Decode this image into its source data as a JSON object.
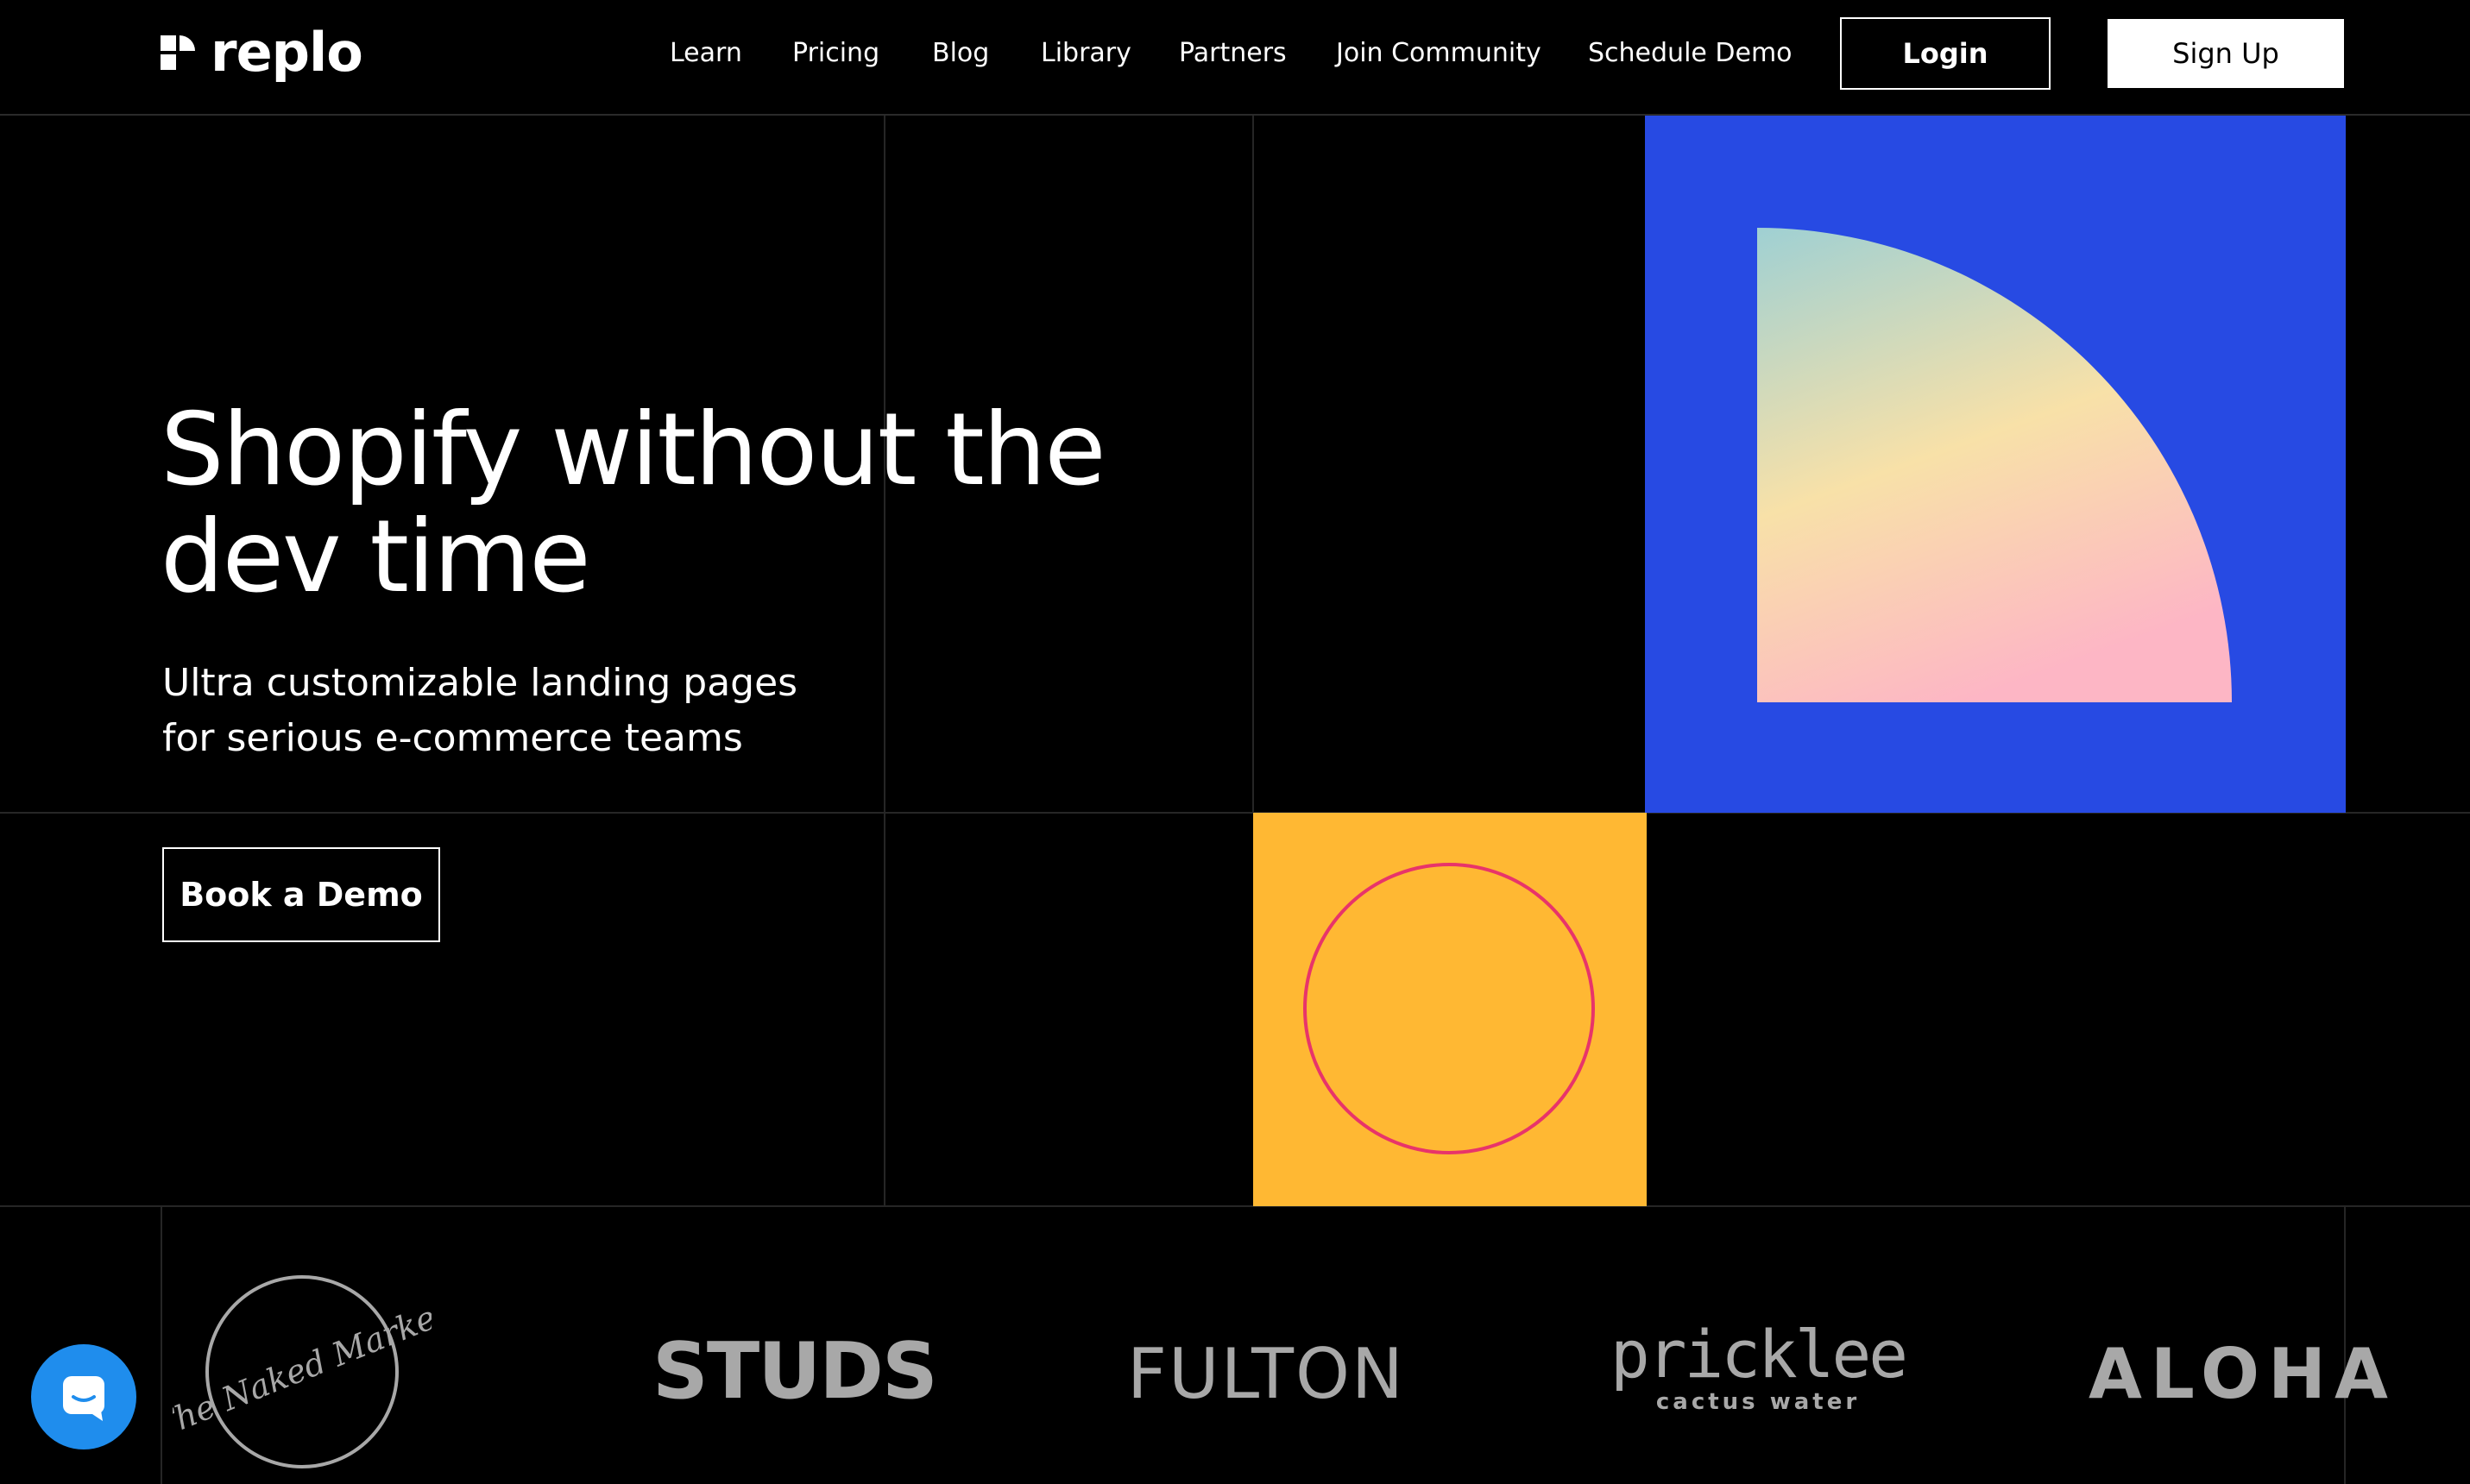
{
  "brand": {
    "name": "replo"
  },
  "nav": {
    "links": [
      "Learn",
      "Pricing",
      "Blog",
      "Library",
      "Partners",
      "Join Community",
      "Schedule Demo"
    ],
    "login_label": "Login",
    "signup_label": "Sign Up"
  },
  "hero": {
    "title_line1": "Shopify without the",
    "title_line2": "dev time",
    "subtitle_line1": "Ultra customizable landing pages",
    "subtitle_line2": "for serious e-commerce teams",
    "cta_label": "Book a Demo"
  },
  "colors": {
    "background": "#000000",
    "blue_block": "#274ae3",
    "yellow_block": "#ffb833",
    "ring": "#e8346a",
    "chat": "#1f8ded"
  },
  "customer_logos": {
    "naked_market": "The Naked Market",
    "studs": "STUDS",
    "fulton": "FULTON",
    "pricklee": "pricklee",
    "pricklee_tagline": "cactus water",
    "aloha": "ALOHA"
  },
  "icons": {
    "logo_mark": "replo-logo-mark",
    "chat": "chat-icon"
  }
}
